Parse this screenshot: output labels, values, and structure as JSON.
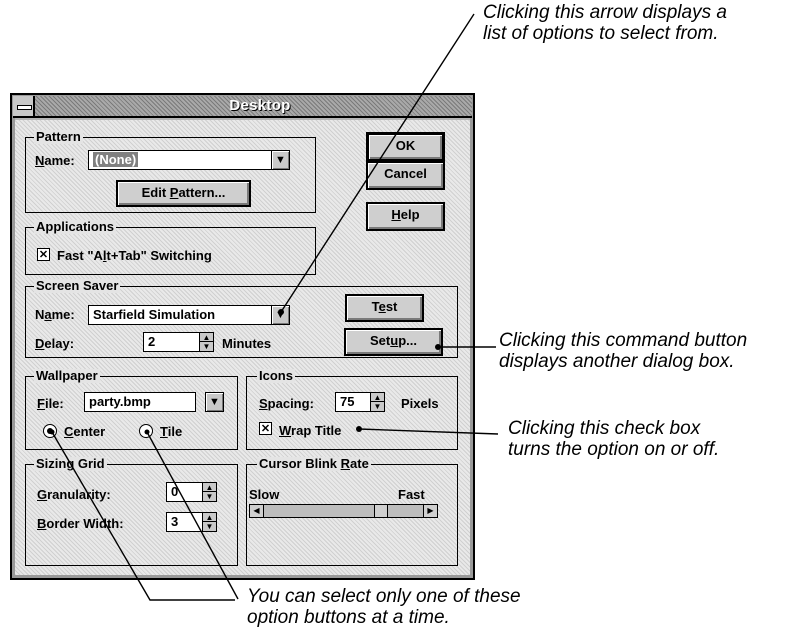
{
  "callouts": {
    "arrow": [
      "Clicking this arrow displays a",
      "list of options to select from."
    ],
    "command": [
      "Clicking this command button",
      "displays another dialog box."
    ],
    "checkbox": [
      "Clicking this check box",
      "turns the option on or off."
    ],
    "option": [
      "You can select only one of these",
      "option buttons at a time."
    ]
  },
  "dialog": {
    "title": "Desktop",
    "buttons": {
      "ok": "OK",
      "cancel": "Cancel",
      "help": "Help"
    },
    "pattern": {
      "label": "Pattern",
      "name_label": "Name:",
      "name_value": "(None)",
      "edit_button": "Edit Pattern..."
    },
    "applications": {
      "label": "Applications",
      "fast_switch": "Fast \"Alt+Tab\" Switching",
      "fast_switch_checked": true
    },
    "screen_saver": {
      "label": "Screen Saver",
      "name_label": "Name:",
      "name_value": "Starfield Simulation",
      "delay_label": "Delay:",
      "delay_value": "2",
      "delay_unit": "Minutes",
      "test_button": "Test",
      "setup_button": "Setup..."
    },
    "wallpaper": {
      "label": "Wallpaper",
      "file_label": "File:",
      "file_value": "party.bmp",
      "center": "Center",
      "tile": "Tile",
      "selected": "Center"
    },
    "icons": {
      "label": "Icons",
      "spacing_label": "Spacing:",
      "spacing_value": "75",
      "spacing_unit": "Pixels",
      "wrap_title": "Wrap Title",
      "wrap_checked": true
    },
    "sizing_grid": {
      "label": "Sizing Grid",
      "granularity_label": "Granularity:",
      "granularity_value": "0",
      "border_label": "Border Width:",
      "border_value": "3"
    },
    "cursor_blink": {
      "label": "Cursor Blink Rate",
      "slow": "Slow",
      "fast": "Fast",
      "level": 0.75
    }
  }
}
